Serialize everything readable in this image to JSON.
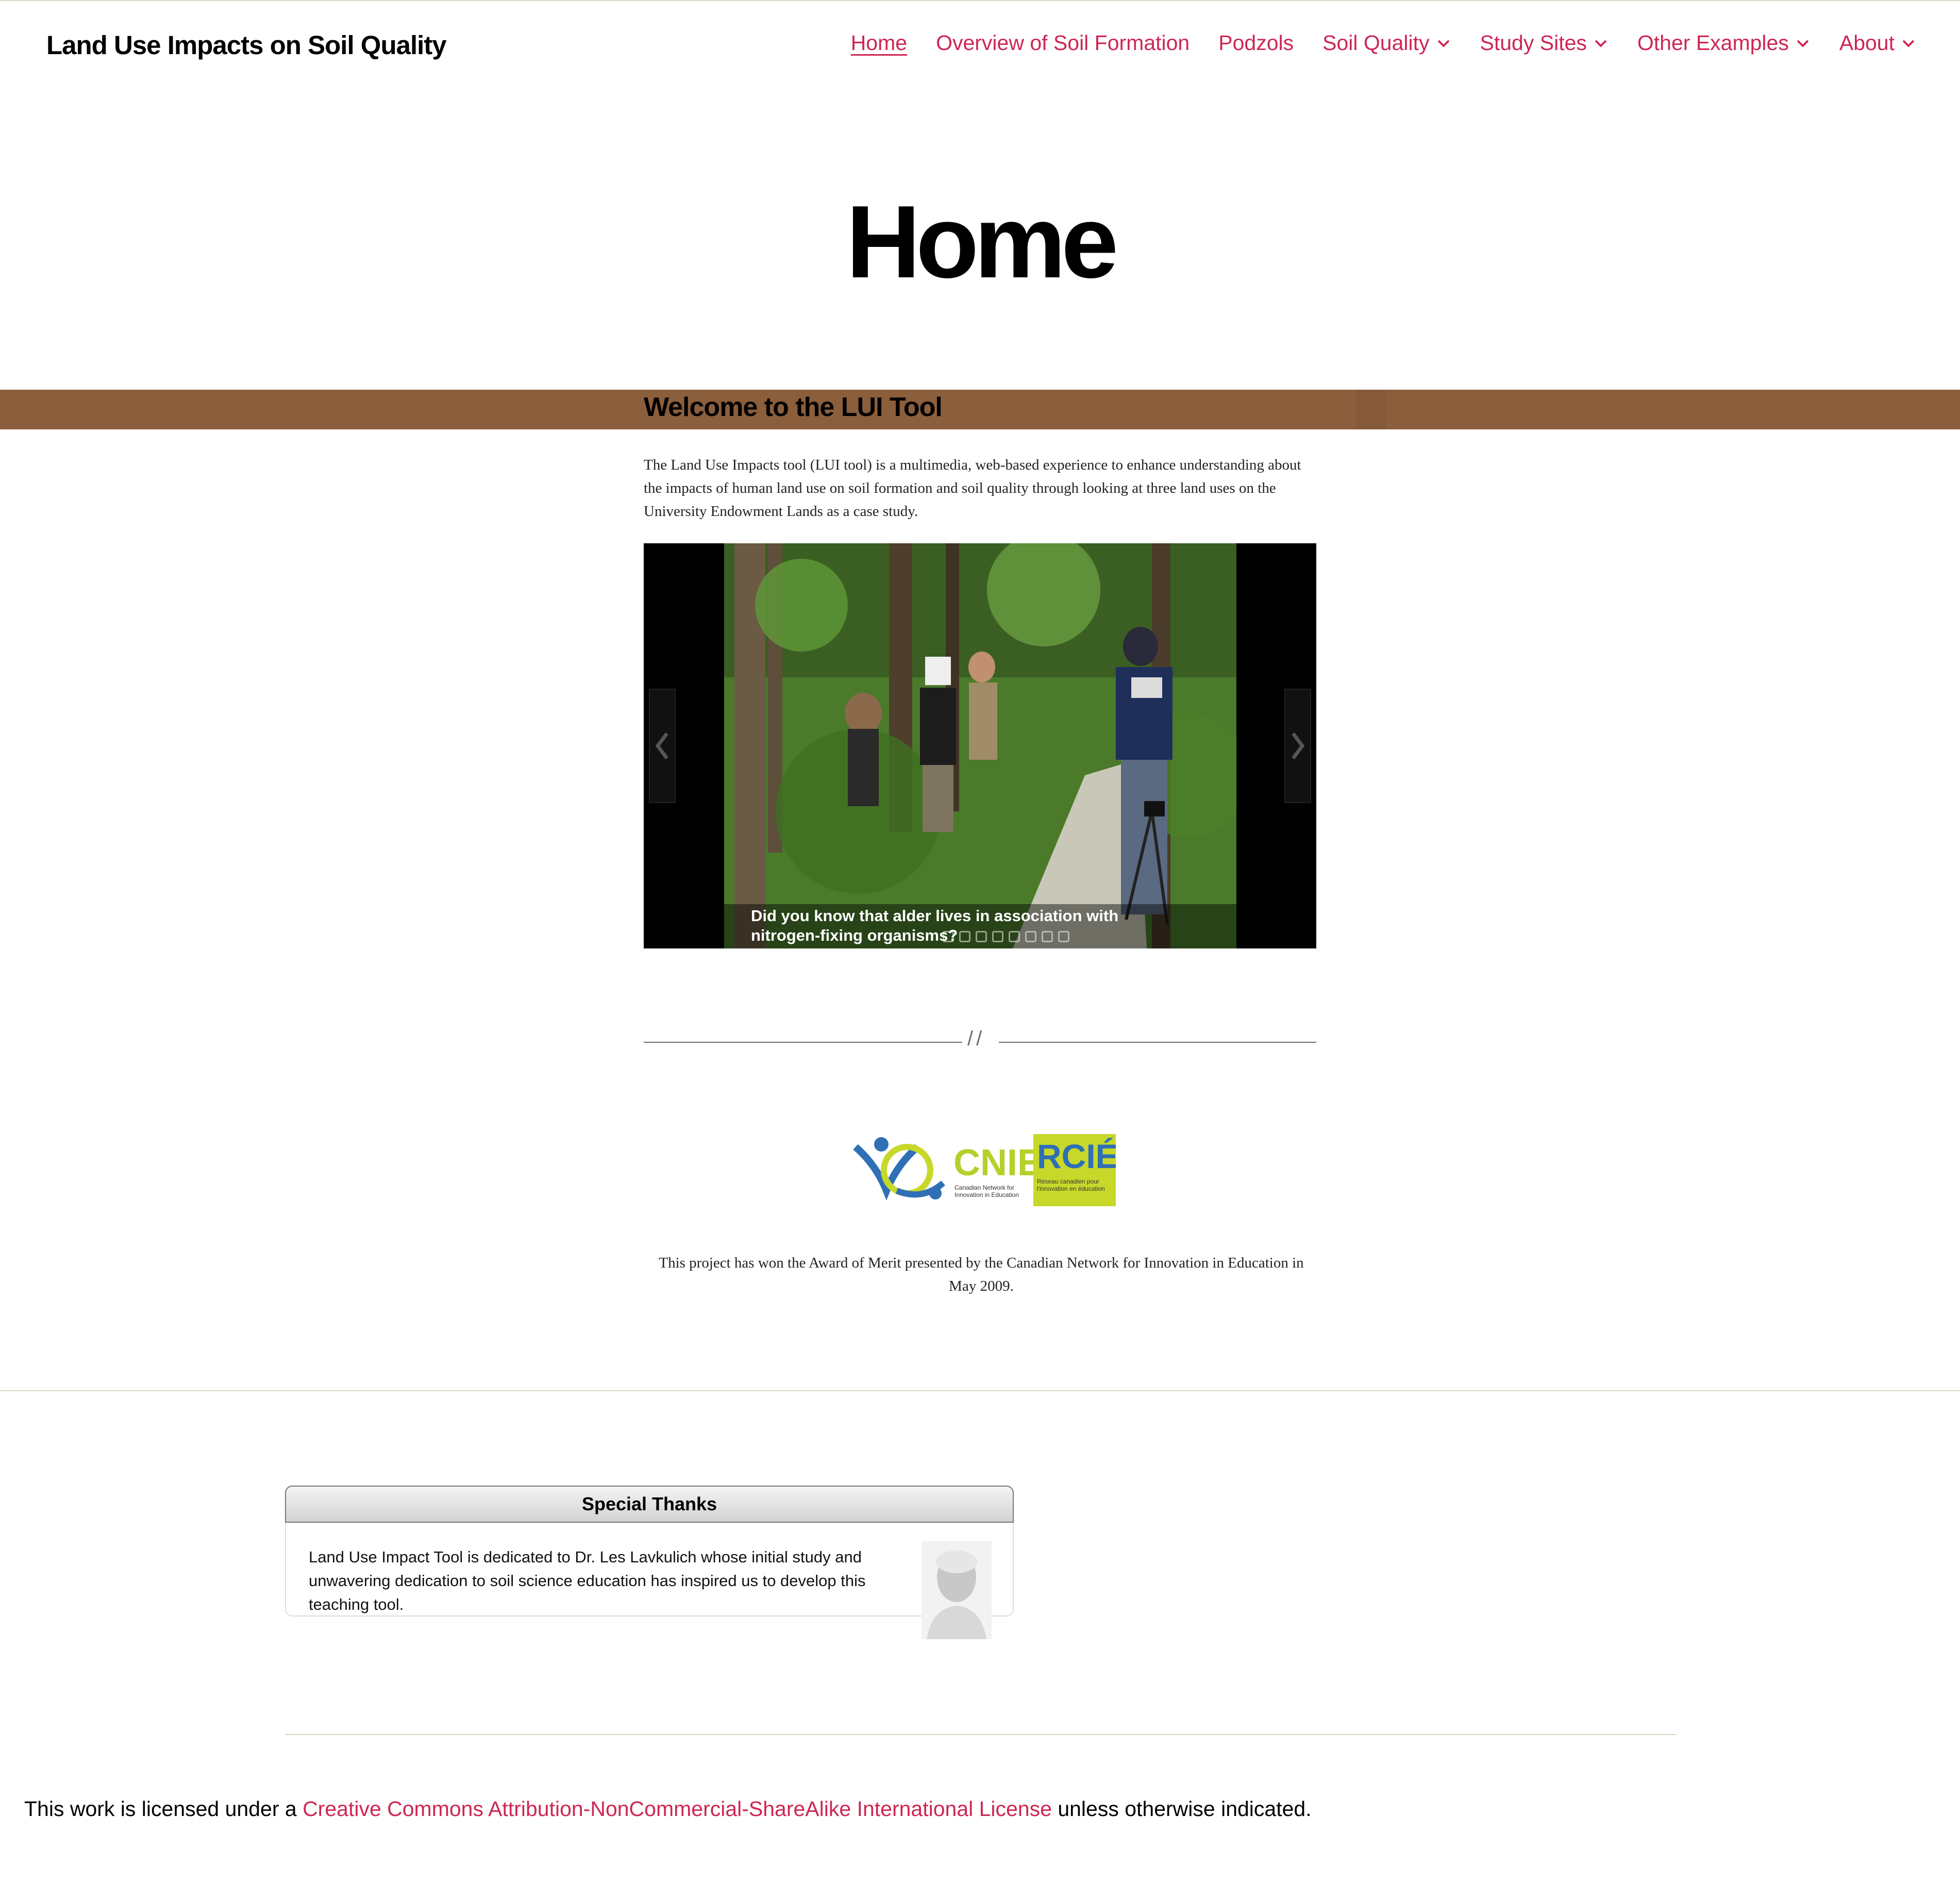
{
  "site": {
    "title": "Land Use Impacts on Soil Quality"
  },
  "nav": {
    "items": [
      {
        "label": "Home",
        "active": true,
        "has_submenu": false
      },
      {
        "label": "Overview of Soil Formation",
        "has_submenu": false
      },
      {
        "label": "Podzols",
        "has_submenu": false
      },
      {
        "label": "Soil Quality",
        "has_submenu": true
      },
      {
        "label": "Study Sites",
        "has_submenu": true
      },
      {
        "label": "Other Examples",
        "has_submenu": true
      },
      {
        "label": "About",
        "has_submenu": true
      }
    ],
    "submenu_icon": "chevron-down-icon"
  },
  "page": {
    "title": "Home",
    "welcome_heading": "Welcome to the LUI Tool",
    "intro": "The Land Use Impacts tool (LUI tool) is a multimedia, web-based experience to enhance understanding about the impacts of human land use on soil formation and soil quality through looking at three land uses on the University Endowment Lands as a case study.",
    "separator": "//",
    "award": "This project has won the Award of Merit presented by the Canadian Network for Innovation in Education in May 2009."
  },
  "slideshow": {
    "caption": "Did you know that alder lives in association with nitrogen-fixing organisms?",
    "slide_count": 8,
    "prev_icon": "chevron-left-icon",
    "next_icon": "chevron-right-icon"
  },
  "logo": {
    "text_cnie": "CNIE",
    "text_rcie": "RCIÉ",
    "sub_en": "Canadian Network for Innovation in Education",
    "sub_fr": "Réseau canadien pour l'innovation en éducation"
  },
  "thanks": {
    "heading": "Special Thanks",
    "text": "Land Use Impact Tool is dedicated to Dr. Les Lavkulich whose initial study and unwavering dedication to soil science education has inspired us to develop this teaching tool."
  },
  "footer": {
    "license_prefix": "This work is licensed under a ",
    "license_link": "Creative Commons Attribution-NonCommercial-ShareAlike International License",
    "license_suffix": " unless otherwise indicated."
  },
  "colors": {
    "accent": "#cd2653",
    "band": "#8b5e3c",
    "text": "#000000"
  }
}
